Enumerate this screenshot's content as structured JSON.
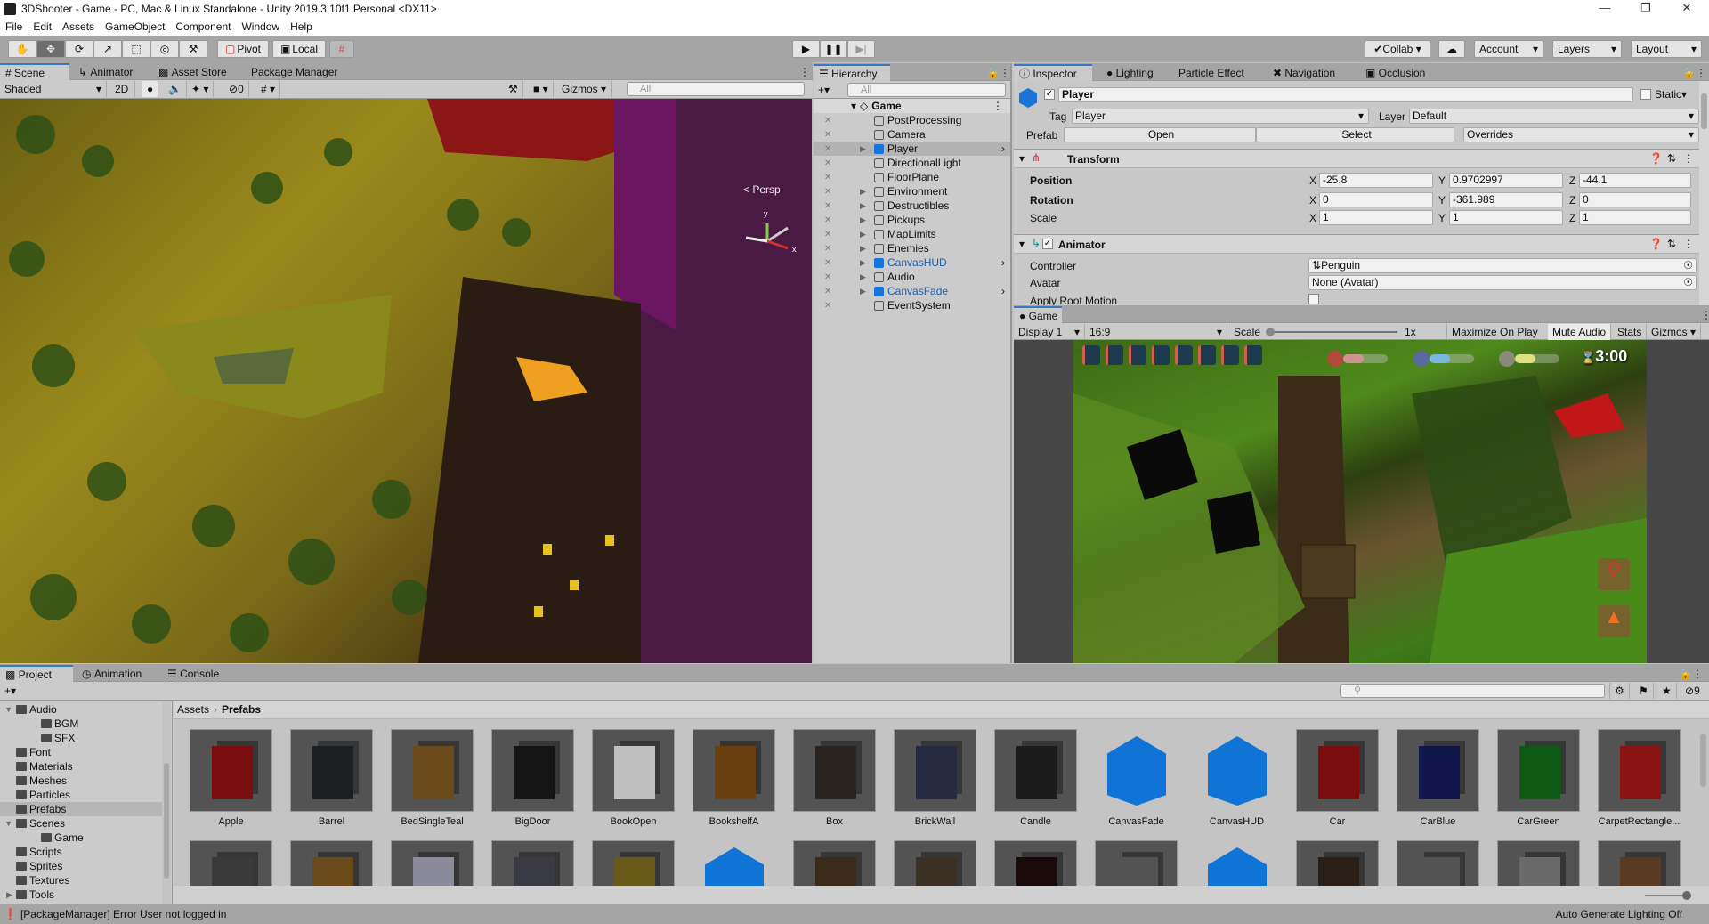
{
  "window": {
    "title": "3DShooter - Game - PC, Mac & Linux Standalone - Unity 2019.3.10f1 Personal <DX11>"
  },
  "menu": [
    "File",
    "Edit",
    "Assets",
    "GameObject",
    "Component",
    "Window",
    "Help"
  ],
  "toolbar": {
    "tools": [
      "hand-icon",
      "move-icon",
      "rotate-icon",
      "scale-icon",
      "rect-icon",
      "transform-icon",
      "custom-tool-icon"
    ],
    "active_tool": 1,
    "pivot": "Pivot",
    "local": "Local",
    "collab": "Collab",
    "account": "Account",
    "layers": "Layers",
    "layout": "Layout"
  },
  "scene_tabs": {
    "scene": "Scene",
    "animator": "Animator",
    "asset_store": "Asset Store",
    "package_manager": "Package Manager"
  },
  "scene_toolbar": {
    "shading": "Shaded",
    "mode_2d": "2D",
    "hidden_count": "0",
    "gizmos": "Gizmos",
    "search_placeholder": "All",
    "persp": "Persp"
  },
  "hierarchy": {
    "title": "Hierarchy",
    "search_placeholder": "All",
    "scene": "Game",
    "items": [
      {
        "label": "PostProcessing"
      },
      {
        "label": "Camera"
      },
      {
        "label": "Player",
        "expandable": true,
        "selected": true,
        "prefab": true
      },
      {
        "label": "DirectionalLight"
      },
      {
        "label": "FloorPlane"
      },
      {
        "label": "Environment",
        "expandable": true
      },
      {
        "label": "Destructibles",
        "expandable": true
      },
      {
        "label": "Pickups",
        "expandable": true
      },
      {
        "label": "MapLimits",
        "expandable": true
      },
      {
        "label": "Enemies",
        "expandable": true
      },
      {
        "label": "CanvasHUD",
        "expandable": true,
        "prefab": true,
        "has_child_arrow": true
      },
      {
        "label": "Audio",
        "expandable": true
      },
      {
        "label": "CanvasFade",
        "expandable": true,
        "prefab": true,
        "has_child_arrow": true
      },
      {
        "label": "EventSystem"
      }
    ]
  },
  "inspector": {
    "tabs": [
      "Inspector",
      "Lighting",
      "Particle Effect",
      "Navigation",
      "Occlusion"
    ],
    "object": {
      "active": true,
      "name": "Player",
      "static_label": "Static",
      "tag_label": "Tag",
      "tag": "Player",
      "layer_label": "Layer",
      "layer": "Default",
      "prefab_label": "Prefab",
      "open": "Open",
      "select": "Select",
      "overrides": "Overrides"
    },
    "transform": {
      "title": "Transform",
      "position": {
        "label": "Position",
        "x": "-25.8",
        "y": "0.9702997",
        "z": "-44.1"
      },
      "rotation": {
        "label": "Rotation",
        "x": "0",
        "y": "-361.989",
        "z": "0"
      },
      "scale": {
        "label": "Scale",
        "x": "1",
        "y": "1",
        "z": "1"
      }
    },
    "animator": {
      "title": "Animator",
      "enabled": true,
      "controller_label": "Controller",
      "controller": "Penguin",
      "avatar_label": "Avatar",
      "avatar": "None (Avatar)",
      "root_motion_label": "Apply Root Motion",
      "root_motion": false
    }
  },
  "game": {
    "tab": "Game",
    "display": "Display 1",
    "aspect": "16:9",
    "scale_label": "Scale",
    "scale_value": "1x",
    "maximize": "Maximize On Play",
    "mute": "Mute Audio",
    "stats": "Stats",
    "gizmos": "Gizmos",
    "hud": {
      "lives": 8,
      "fire_level": 0.45,
      "ice_level": 0.45,
      "wind_level": 0.45,
      "timer": "3:00"
    }
  },
  "project": {
    "tabs": [
      "Project",
      "Animation",
      "Console"
    ],
    "hidden_count": "9",
    "folders": [
      {
        "label": "Audio",
        "depth": 0,
        "expanded": true
      },
      {
        "label": "BGM",
        "depth": 1
      },
      {
        "label": "SFX",
        "depth": 1
      },
      {
        "label": "Font",
        "depth": 0
      },
      {
        "label": "Materials",
        "depth": 0
      },
      {
        "label": "Meshes",
        "depth": 0
      },
      {
        "label": "Particles",
        "depth": 0
      },
      {
        "label": "Prefabs",
        "depth": 0,
        "selected": true
      },
      {
        "label": "Scenes",
        "depth": 0,
        "expanded": true
      },
      {
        "label": "Game",
        "depth": 1
      },
      {
        "label": "Scripts",
        "depth": 0
      },
      {
        "label": "Sprites",
        "depth": 0
      },
      {
        "label": "Textures",
        "depth": 0
      },
      {
        "label": "Tools",
        "depth": 0,
        "collapsed": true
      }
    ],
    "breadcrumb": [
      "Assets",
      "Prefabs"
    ],
    "assets": [
      {
        "label": "Apple",
        "color": "#7a0d0d"
      },
      {
        "label": "Barrel",
        "color": "#1c1f22"
      },
      {
        "label": "BedSingleTeal",
        "color": "#6a4a1a"
      },
      {
        "label": "BigDoor",
        "color": "#151515"
      },
      {
        "label": "BookOpen",
        "color": "#bfbfbf"
      },
      {
        "label": "BookshelfA",
        "color": "#6a3f10"
      },
      {
        "label": "Box",
        "color": "#2a2420"
      },
      {
        "label": "BrickWall",
        "color": "#252a40"
      },
      {
        "label": "Candle",
        "color": "#1c1c1c"
      },
      {
        "label": "CanvasFade",
        "color": "#1074d6",
        "icon": "blue-cube-icon"
      },
      {
        "label": "CanvasHUD",
        "color": "#1074d6",
        "icon": "blue-cube-icon"
      },
      {
        "label": "Car",
        "color": "#7a0d0d"
      },
      {
        "label": "CarBlue",
        "color": "#10164a"
      },
      {
        "label": "CarGreen",
        "color": "#0d5a15"
      },
      {
        "label": "CarpetRectangle...",
        "color": "#8a1414"
      }
    ]
  },
  "status": {
    "message": "[PackageManager] Error User not logged in",
    "lighting": "Auto Generate Lighting Off"
  }
}
